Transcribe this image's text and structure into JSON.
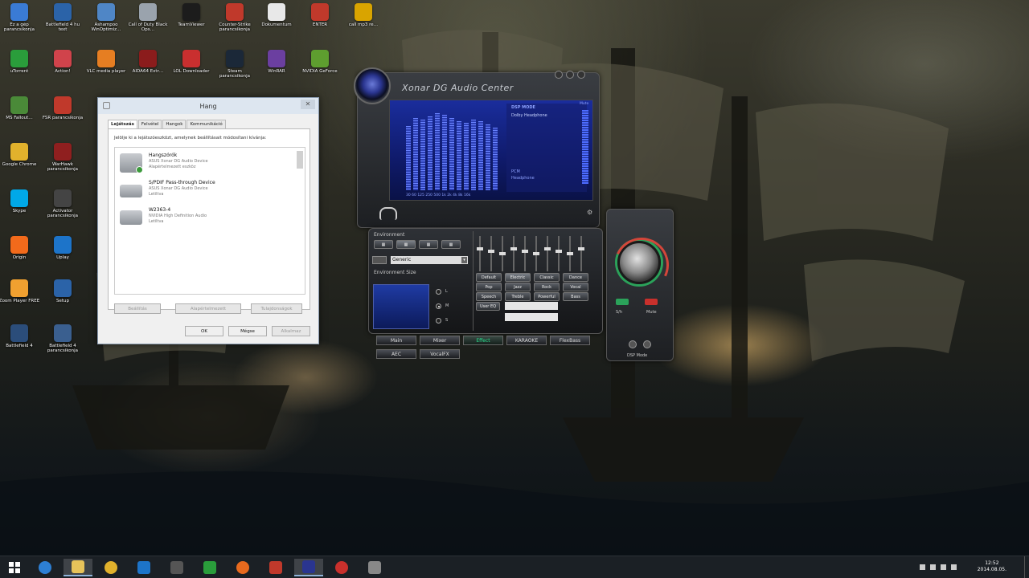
{
  "desktop": {
    "icons": [
      {
        "label": "Ez a gép parancsikonja",
        "color": "#3a7bd5"
      },
      {
        "label": "Battlefield 4 hu text",
        "color": "#2b63a8"
      },
      {
        "label": "Ashampoo WinOptimiz…",
        "color": "#4f86c6"
      },
      {
        "label": "Call of Duty Black Ops…",
        "color": "#9aa3ad"
      },
      {
        "label": "TeamViewer",
        "color": "#1c1c1c"
      },
      {
        "label": "Counter-Strike parancsikonja",
        "color": "#c0392b"
      },
      {
        "label": "Dokumentum",
        "color": "#e8e8e8"
      },
      {
        "label": "ENTER",
        "color": "#c0392b"
      },
      {
        "label": "call mp3 re…",
        "color": "#d9a400"
      },
      {
        "label": "uTorrent",
        "color": "#2a9d3b"
      },
      {
        "label": "Action!",
        "color": "#d0434b"
      },
      {
        "label": "VLC media player",
        "color": "#e67e22"
      },
      {
        "label": "AIDA64 Extr…",
        "color": "#8b1c1c"
      },
      {
        "label": "LOL Downloader",
        "color": "#c92f2f"
      },
      {
        "label": "Steam parancsikonja",
        "color": "#1b2838"
      },
      {
        "label": "WinRAR",
        "color": "#6b3fa0"
      },
      {
        "label": "NVIDIA GeForce",
        "color": "#5e9e2f"
      },
      {
        "label": "MS Fallout…",
        "color": "#4a8a38"
      },
      {
        "label": "FSR parancsikonja",
        "color": "#c0392b"
      },
      {
        "label": "Google Chrome",
        "color": "#e1b12c"
      },
      {
        "label": "WarHawk parancsikonja",
        "color": "#8f1f1f"
      },
      {
        "label": "Skype",
        "color": "#00a8e8"
      },
      {
        "label": "Activator parancsikonja",
        "color": "#444"
      },
      {
        "label": "Origin",
        "color": "#f26a1b"
      },
      {
        "label": "Uplay",
        "color": "#1d74c9"
      },
      {
        "label": "Zoom Player FREE",
        "color": "#f0a030"
      },
      {
        "label": "Setup",
        "color": "#2b63a8"
      },
      {
        "label": "Battlefield 4",
        "color": "#2b4d7a"
      },
      {
        "label": "Battlefield 4 parancsikonja",
        "color": "#3a5f8f"
      }
    ]
  },
  "hang": {
    "title": "Hang",
    "tabs": [
      "Lejátszás",
      "Felvétel",
      "Hangok",
      "Kommunikáció"
    ],
    "instruction": "Jelölje ki a lejátszóeszközt, amelynek beállításait módosítani kívánja:",
    "devices": [
      {
        "name": "Hangszórók",
        "line1": "ASUS Xonar DG Audio Device",
        "line2": "Alapértelmezett eszköz",
        "default": true
      },
      {
        "name": "S/PDIF Pass-through Device",
        "line1": "ASUS Xonar DG Audio Device",
        "line2": "Letiltva",
        "default": false
      },
      {
        "name": "W2363-4",
        "line1": "NVIDIA High Definition Audio",
        "line2": "Letiltva",
        "default": false
      }
    ],
    "buttons": {
      "configure": "Beállítás",
      "set_default": "Alapértelmezett",
      "properties": "Tulajdonságok",
      "ok": "OK",
      "cancel": "Mégse",
      "apply": "Alkalmaz"
    }
  },
  "xonar": {
    "title": "Xonar DG Audio Center",
    "dsp_mode": "DSP MODE",
    "dsp_items": [
      "Dolby Headphone",
      "PCM",
      "Headphone"
    ],
    "mute_label": "Mute",
    "eq_axis": "30 60 125 250 500 1k 2k 4k 8k 16k",
    "environment_label": "Environment",
    "environment_value": "Generic",
    "env_size_label": "Environment Size",
    "size_options": [
      "L",
      "M",
      "S"
    ],
    "eq_presets": [
      "Default",
      "Electric",
      "Classic",
      "Dance",
      "Pop",
      "Jazz",
      "Rock",
      "Vocal",
      "Speech",
      "Treble",
      "Powerful",
      "Bass"
    ],
    "user_eq_label": "User EQ",
    "tabs_row1": [
      "Main",
      "Mixer",
      "Effect",
      "KARAOKE",
      "FlexBass"
    ],
    "tabs_row2": [
      "AEC",
      "VocalFX"
    ],
    "active_tab": "Effect",
    "knob_labels": [
      "S/h",
      "Mute"
    ],
    "dsp_mode_bottom": "DSP Mode"
  },
  "taskbar": {
    "time": "12:52",
    "date": "2014.08.05."
  }
}
